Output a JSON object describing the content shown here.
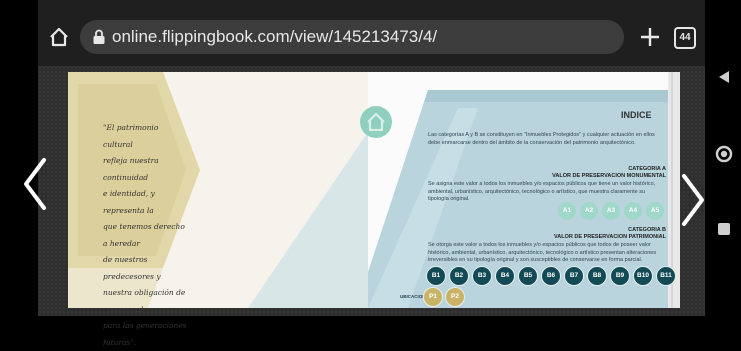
{
  "browser": {
    "url": "online.flippingbook.com/view/145213473/4/",
    "tab_count": "44"
  },
  "page_left": {
    "quote_lines": [
      "\"El patrimonio cultural",
      "refleja nuestra continuidad",
      "e identidad, y representa la",
      "que tenemos derecho a heredar",
      "de nuestros predecesores y",
      "nuestra obligación de",
      "conservarlo a su vez",
      "para las generaciones",
      "futuras\"."
    ]
  },
  "page_right": {
    "title": "INDICE",
    "intro": "Las categorías A y B se constituyen en \"Inmuebles Protegidos\" y cualquier actuación en ellos debe enmarcarse dentro del ámbito de la conservación del patrimonio arquitectónico.",
    "cat_a_label": "CATEGORIA A",
    "cat_a_title": "VALOR DE PRESERVACION MONUMENTAL",
    "cat_a_text": "Se asigna este valor a todos los inmuebles y/o espacios públicos que tiene un valor histórico, ambiental, urbanístico, arquitectónico, tecnológico o artístico, que muestra claramente su tipología original.",
    "cat_b_label": "CATEGORIA B",
    "cat_b_title": "VALOR DE PRESERVACION PATRIMONIAL",
    "cat_b_text": "Se otorga este valor a todos los inmuebles y/o espacios públicos que todos de poseer valor histórico, ambiental, urbanístico, arquitectónico, tecnológico o artístico presentan alteraciones irreversibles en su tipología original y son susceptibles de conservarse en forma parcial.",
    "a_items": [
      "A1",
      "A2",
      "A3",
      "A4",
      "A5"
    ],
    "b_items": [
      "B1",
      "B2",
      "B3",
      "B4",
      "B5",
      "B6",
      "B7",
      "B8",
      "B9",
      "B10",
      "B11"
    ],
    "ubicacion_label": "UBICACION",
    "p_items": [
      "P1",
      "P2"
    ]
  },
  "colors": {
    "page_bg": "#fbfbfb",
    "teal_accent": "#9fd8c8",
    "dark_sticker": "#124a55",
    "gold": "#c9b366",
    "tan_shape": "#d8cb94",
    "blue_wash": "#b8d3dc"
  }
}
